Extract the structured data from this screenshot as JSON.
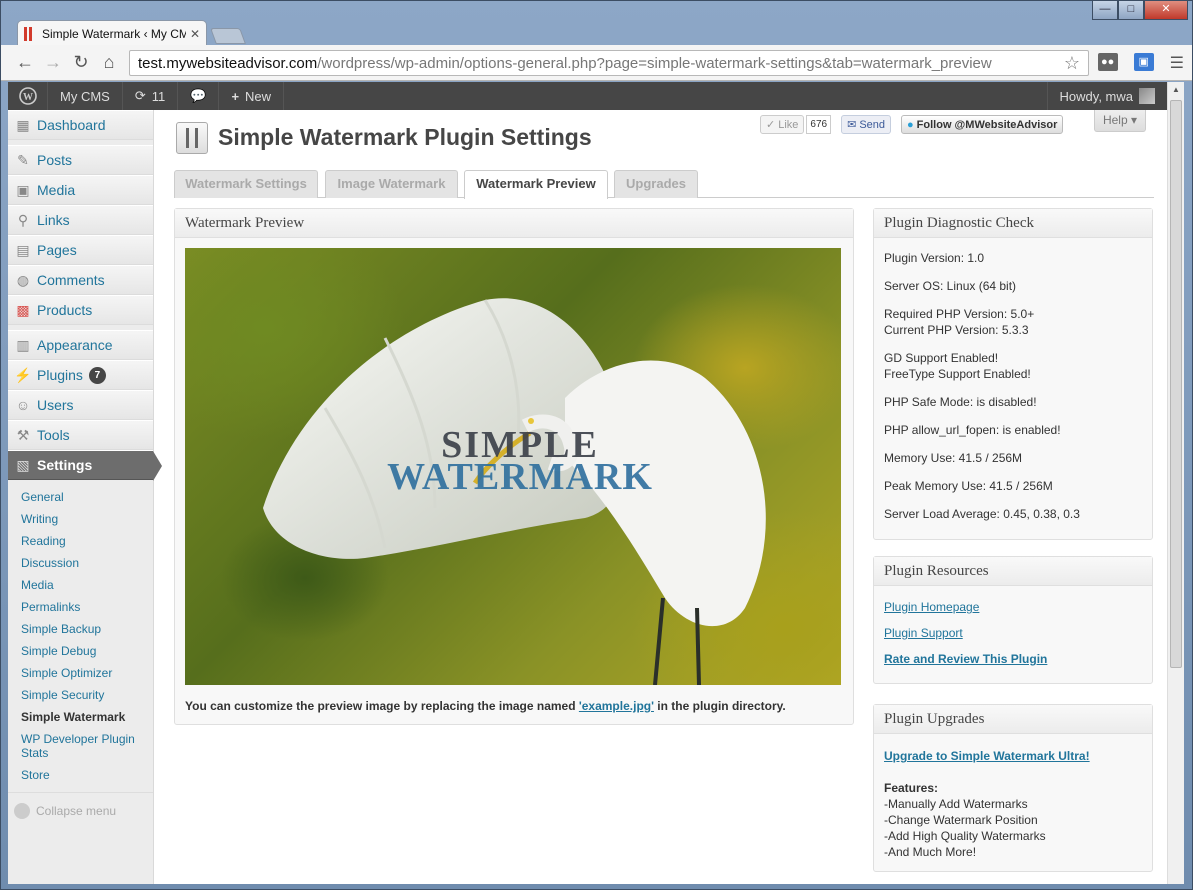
{
  "browser": {
    "tab_title": "Simple Watermark ‹ My CMS",
    "url_host": "test.mywebsiteadvisor.com",
    "url_path": "/wordpress/wp-admin/options-general.php?page=simple-watermark-settings&tab=watermark_preview",
    "minimize": "—",
    "maximize": "□",
    "close": "✕"
  },
  "adminbar": {
    "site": "My CMS",
    "updates": "11",
    "new": "New",
    "howdy": "Howdy, mwa"
  },
  "sidebar": {
    "items": [
      {
        "label": "Dashboard",
        "icon": "dashboard-icon"
      },
      {
        "label": "Posts",
        "icon": "posts-icon"
      },
      {
        "label": "Media",
        "icon": "media-icon"
      },
      {
        "label": "Links",
        "icon": "links-icon"
      },
      {
        "label": "Pages",
        "icon": "pages-icon"
      },
      {
        "label": "Comments",
        "icon": "comments-icon"
      },
      {
        "label": "Products",
        "icon": "products-icon"
      },
      {
        "label": "Appearance",
        "icon": "appearance-icon"
      },
      {
        "label": "Plugins",
        "icon": "plugins-icon",
        "badge": "7"
      },
      {
        "label": "Users",
        "icon": "users-icon"
      },
      {
        "label": "Tools",
        "icon": "tools-icon"
      },
      {
        "label": "Settings",
        "icon": "settings-icon"
      }
    ],
    "submenu": [
      "General",
      "Writing",
      "Reading",
      "Discussion",
      "Media",
      "Permalinks",
      "Simple Backup",
      "Simple Debug",
      "Simple Optimizer",
      "Simple Security",
      "Simple Watermark",
      "WP Developer Plugin Stats",
      "Store"
    ],
    "collapse": "Collapse menu"
  },
  "header": {
    "title": "Simple Watermark Plugin Settings",
    "like": "Like",
    "like_count": "676",
    "send": "Send",
    "follow": "Follow @MWebsiteAdvisor",
    "help": "Help"
  },
  "tabs": [
    "Watermark Settings",
    "Image Watermark",
    "Watermark Preview",
    "Upgrades"
  ],
  "preview": {
    "heading": "Watermark Preview",
    "watermark_line1": "SIMPLE",
    "watermark_line2": "WATERMARK",
    "note_before": "You can customize the preview image by replacing the image named ",
    "note_link": "'example.jpg'",
    "note_after": " in the plugin directory."
  },
  "diagnostic": {
    "heading": "Plugin Diagnostic Check",
    "lines": [
      [
        "Plugin Version: 1.0"
      ],
      [
        "Server OS: Linux (64 bit)"
      ],
      [
        "Required PHP Version: 5.0+",
        "Current PHP Version: 5.3.3"
      ],
      [
        "GD Support Enabled!",
        "FreeType Support Enabled!"
      ],
      [
        "PHP Safe Mode: is disabled!"
      ],
      [
        "PHP allow_url_fopen: is enabled!"
      ],
      [
        "Memory Use: 41.5 / 256M"
      ],
      [
        "Peak Memory Use: 41.5 / 256M"
      ],
      [
        "Server Load Average: 0.45, 0.38, 0.3"
      ]
    ]
  },
  "resources": {
    "heading": "Plugin Resources",
    "homepage": "Plugin Homepage",
    "support": "Plugin Support",
    "rate": "Rate and Review This Plugin"
  },
  "upgrades": {
    "heading": "Plugin Upgrades",
    "link": "Upgrade to Simple Watermark Ultra!",
    "features_label": "Features:",
    "features": [
      "-Manually Add Watermarks",
      "-Change Watermark Position",
      "-Add High Quality Watermarks",
      "-And Much More!"
    ]
  },
  "colors": {
    "link": "#21759b",
    "adminbar": "#464646",
    "menu_current": "#6d6d6d"
  }
}
